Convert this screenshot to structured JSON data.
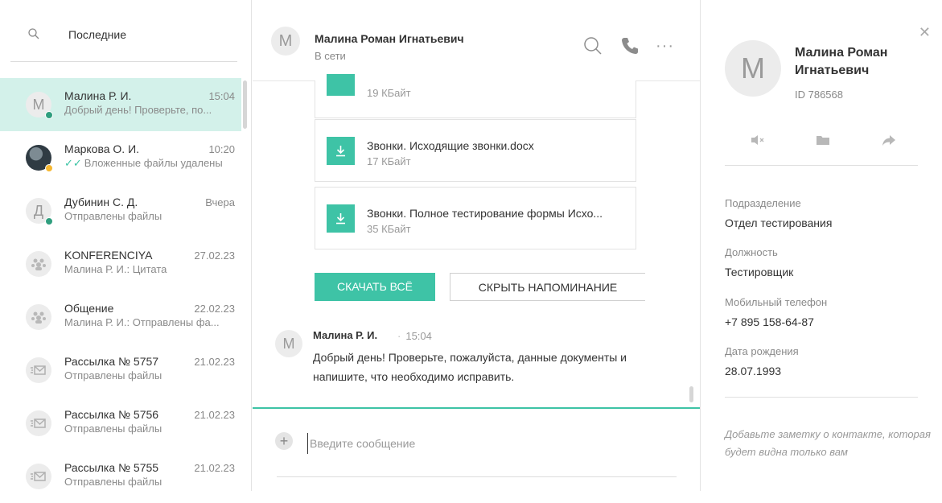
{
  "left": {
    "search_label": "Последние",
    "chats": [
      {
        "initial": "М",
        "name": "Малина Р. И.",
        "time": "15:04",
        "preview": "Добрый день! Проверьте, по...",
        "status": "online"
      },
      {
        "initial": "",
        "name": "Маркова О. И.",
        "time": "10:20",
        "preview": "Вложенные файлы удалены",
        "status": "away",
        "checkmarks": "✓✓"
      },
      {
        "initial": "Д",
        "name": "Дубинин С. Д.",
        "time": "Вчера",
        "preview": "Отправлены файлы",
        "status": "online"
      },
      {
        "initial": "",
        "name": "KONFERENCIYA",
        "time": "27.02.23",
        "preview": "Малина Р. И.: Цитата"
      },
      {
        "initial": "",
        "name": "Общение",
        "time": "22.02.23",
        "preview": "Малина Р. И.: Отправлены фа..."
      },
      {
        "initial": "",
        "name": "Рассылка № 5757",
        "time": "21.02.23",
        "preview": "Отправлены файлы"
      },
      {
        "initial": "",
        "name": "Рассылка № 5756",
        "time": "21.02.23",
        "preview": "Отправлены файлы"
      },
      {
        "initial": "",
        "name": "Рассылка № 5755",
        "time": "21.02.23",
        "preview": "Отправлены файлы"
      }
    ]
  },
  "header": {
    "avatar_initial": "М",
    "name": "Малина Роман Игнатьевич",
    "status": "В сети",
    "more": "···"
  },
  "files": [
    {
      "name": "",
      "size": "19 КБайт"
    },
    {
      "name": "Звонки. Исходящие звонки.docx",
      "size": "17 КБайт"
    },
    {
      "name": "Звонки. Полное тестирование формы Исхо...",
      "size": "35 КБайт"
    }
  ],
  "buttons": {
    "download_all": "СКАЧАТЬ ВСЁ",
    "hide_reminder": "СКРЫТЬ НАПОМИНАНИЕ"
  },
  "message": {
    "avatar_initial": "М",
    "author": "Малина Р. И.",
    "time": "15:04",
    "text": "Добрый день! Проверьте, пожалуйста, данные документы и напишите, что необходимо исправить."
  },
  "compose": {
    "placeholder": "Введите сообщение"
  },
  "profile": {
    "avatar_initial": "М",
    "name": "Малина Роман Игнатьевич",
    "id": "ID 786568",
    "fields": [
      {
        "label": "Подразделение",
        "value": "Отдел тестирования"
      },
      {
        "label": "Должность",
        "value": "Тестировщик"
      },
      {
        "label": "Мобильный телефон",
        "value": "+7  895 158-64-87"
      },
      {
        "label": "Дата рождения",
        "value": "28.07.1993"
      }
    ],
    "note_placeholder": "Добавьте заметку о контакте, которая будет видна только вам"
  },
  "colors": {
    "accent": "#3ec3a6",
    "active_row": "#d3f1ea",
    "online": "#2f9e7e",
    "away": "#f5b731"
  }
}
